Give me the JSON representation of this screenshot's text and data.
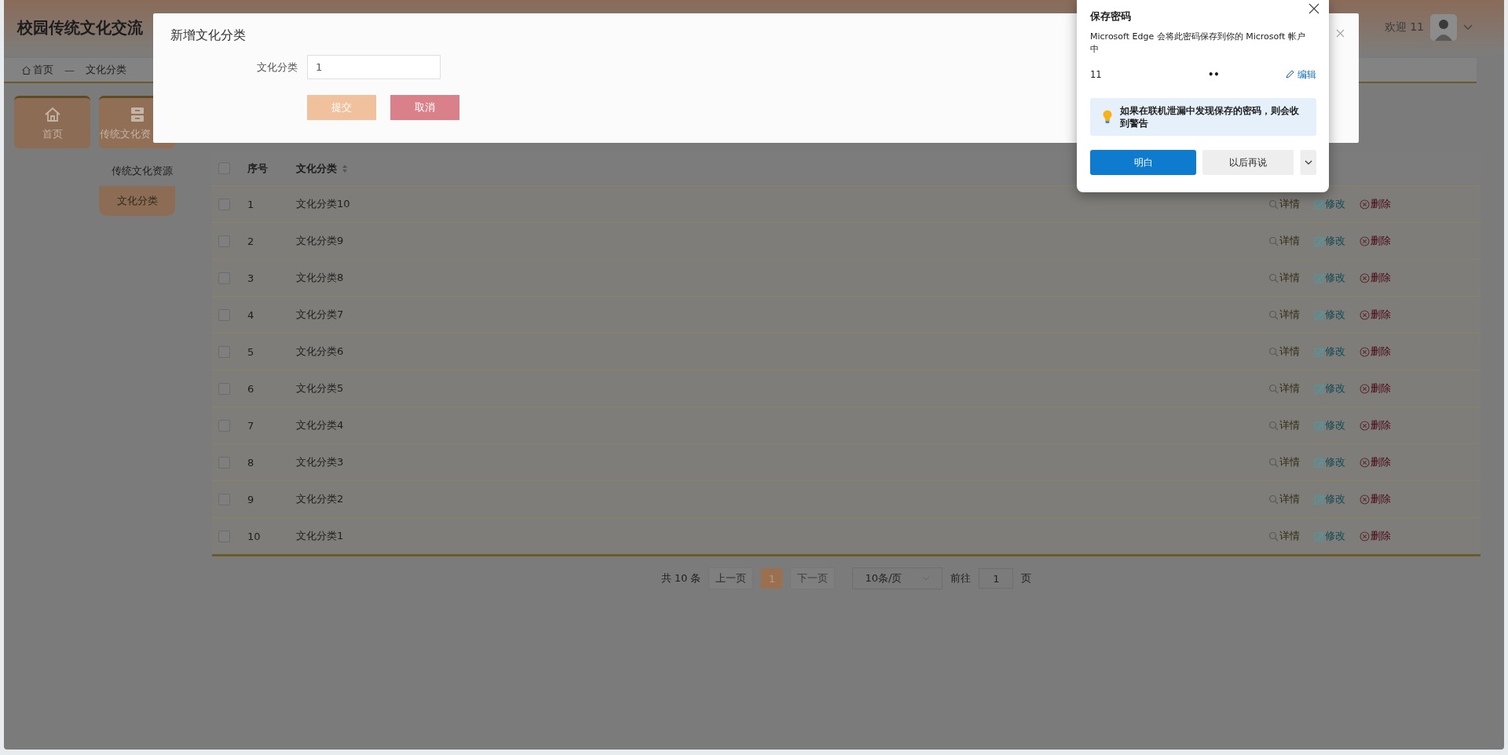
{
  "header": {
    "title": "校园传统文化交流",
    "welcome": "欢迎 11"
  },
  "breadcrumb": {
    "items": [
      "首页",
      "文化分类"
    ],
    "separator": "—"
  },
  "sidebar": {
    "tiles": [
      {
        "label": "首页",
        "selected": false
      },
      {
        "label": "传统文化资",
        "selected": true
      }
    ],
    "submenu": [
      {
        "label": "传统文化资源",
        "selected": false
      },
      {
        "label": "文化分类",
        "selected": true
      }
    ]
  },
  "table": {
    "header_checked": false,
    "columns": [
      "序号",
      "文化分类"
    ],
    "rows": [
      {
        "no": "1",
        "name": "文化分类10",
        "checked": false,
        "actions": [
          "详情",
          "修改",
          "删除"
        ]
      },
      {
        "no": "2",
        "name": "文化分类9",
        "checked": false,
        "actions": [
          "详情",
          "修改",
          "删除"
        ]
      },
      {
        "no": "3",
        "name": "文化分类8",
        "checked": false,
        "actions": [
          "详情",
          "修改",
          "删除"
        ]
      },
      {
        "no": "4",
        "name": "文化分类7",
        "checked": false,
        "actions": [
          "详情",
          "修改",
          "删除"
        ]
      },
      {
        "no": "5",
        "name": "文化分类6",
        "checked": false,
        "actions": [
          "详情",
          "修改",
          "删除"
        ]
      },
      {
        "no": "6",
        "name": "文化分类5",
        "checked": false,
        "actions": [
          "详情",
          "修改",
          "删除"
        ]
      },
      {
        "no": "7",
        "name": "文化分类4",
        "checked": false,
        "actions": [
          "详情",
          "修改",
          "删除"
        ]
      },
      {
        "no": "8",
        "name": "文化分类3",
        "checked": false,
        "actions": [
          "详情",
          "修改",
          "删除"
        ]
      },
      {
        "no": "9",
        "name": "文化分类2",
        "checked": false,
        "actions": [
          "详情",
          "修改",
          "删除"
        ]
      },
      {
        "no": "10",
        "name": "文化分类1",
        "checked": false,
        "actions": [
          "详情",
          "修改",
          "删除"
        ]
      }
    ]
  },
  "pagination": {
    "total": "共 10 条",
    "prev": "上一页",
    "pages": [
      {
        "label": "1",
        "selected": true
      }
    ],
    "next": "下一页",
    "page_size": "10条/页",
    "goto_label": "前往",
    "goto_value": "1",
    "page_unit": "页"
  },
  "dialog": {
    "title": "新增文化分类",
    "fields": [
      {
        "label": "文化分类",
        "value": "1"
      }
    ],
    "buttons": [
      {
        "label": "提交",
        "kind": "primary"
      },
      {
        "label": "取消",
        "kind": "cancel"
      }
    ]
  },
  "password_popup": {
    "title": "保存密码",
    "message": "Microsoft Edge 会将此密码保存到你的 Microsoft 帐户中",
    "username": "11",
    "password": "••",
    "edit": "编辑",
    "notice": "如果在联机泄漏中发现保存的密码，则会收到警告",
    "buttons": [
      {
        "label": "明白",
        "kind": "primary"
      },
      {
        "label": "以后再说",
        "kind": "secondary"
      }
    ]
  }
}
